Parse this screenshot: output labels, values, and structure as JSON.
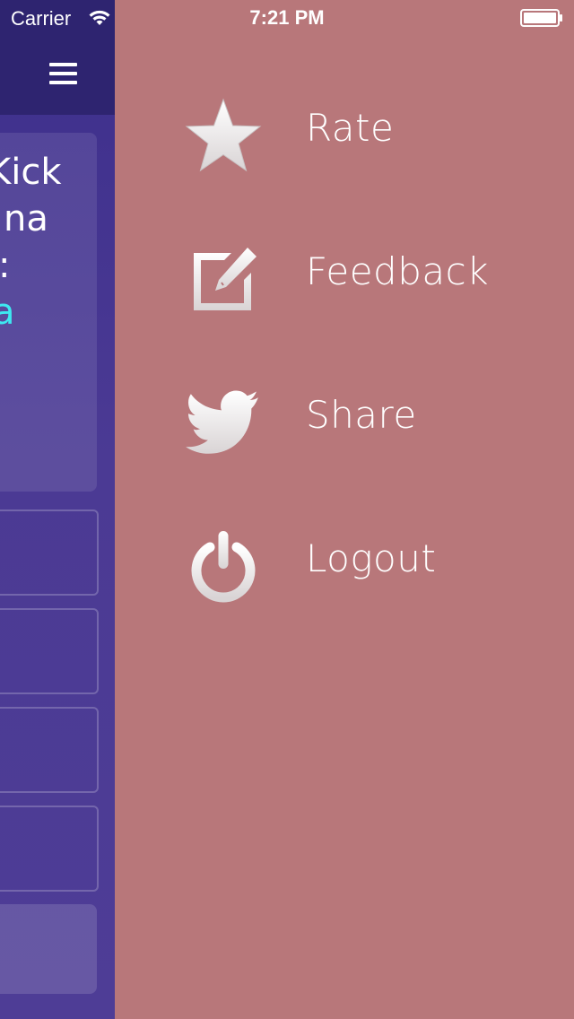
{
  "status_bar": {
    "carrier": "Carrier",
    "time": "7:21 PM"
  },
  "background_panel": {
    "card_lines": [
      "Kick",
      "na",
      ":",
      "a"
    ]
  },
  "menu": {
    "items": [
      {
        "label": "Rate",
        "icon": "star-icon"
      },
      {
        "label": "Feedback",
        "icon": "edit-icon"
      },
      {
        "label": "Share",
        "icon": "twitter-bird-icon"
      },
      {
        "label": "Logout",
        "icon": "power-icon"
      }
    ]
  },
  "colors": {
    "menu_background": "#b8777a",
    "panel_purple": "#4b3a94",
    "navbar_purple": "#2e2470",
    "accent_cyan": "#3ee8f0"
  }
}
